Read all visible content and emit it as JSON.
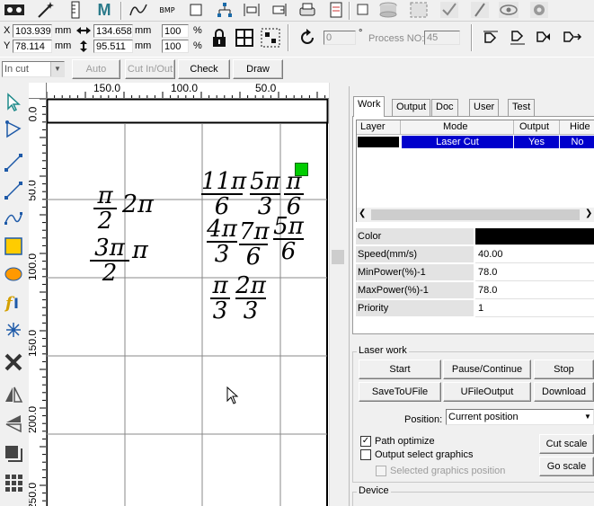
{
  "toolbar": {
    "bmp_label": "BMP",
    "m_label": "M",
    "x_label": "X",
    "y_label": "Y",
    "x_value": "103.939",
    "y_value": "78.114",
    "x_unit": "mm",
    "y_unit": "mm",
    "width_value": "134.658",
    "height_value": "95.511",
    "width_unit": "mm",
    "height_unit": "mm",
    "scale_x": "100",
    "scale_y": "100",
    "pct": "%",
    "rotate_value": "0",
    "degree_sign": "°",
    "process_no_label": "Process NO:",
    "process_no_value": "45"
  },
  "cut_bar": {
    "mode_select": "In cut",
    "auto_label": "Auto",
    "cut_inout_label": "Cut In/Out",
    "check_label": "Check",
    "draw_label": "Draw"
  },
  "ruler": {
    "top_labels": [
      "150.0",
      "100.0",
      "50.0"
    ],
    "left_labels": [
      "0.0",
      "50.0",
      "100.0",
      "150.0",
      "200.0",
      "250.0"
    ]
  },
  "canvas": {
    "math": {
      "f1": {
        "num": "π",
        "den": "2"
      },
      "i1": "2π",
      "f2": {
        "num": "3π",
        "den": "2"
      },
      "i2": "π",
      "f3": {
        "num": "11π",
        "den": "6"
      },
      "f4": {
        "num": "5π",
        "den": "3"
      },
      "f5": {
        "num": "π",
        "den": "6"
      },
      "f6": {
        "num": "4π",
        "den": "3"
      },
      "f7": {
        "num": "7π",
        "den": "6"
      },
      "f8": {
        "num": "5π",
        "den": "6"
      },
      "f9": {
        "num": "π",
        "den": "3"
      },
      "f10": {
        "num": "2π",
        "den": "3"
      }
    }
  },
  "tabs": [
    "Work",
    "Output",
    "Doc",
    "User",
    "Test"
  ],
  "layer_table": {
    "headers": [
      "Layer",
      "Mode",
      "Output",
      "Hide"
    ],
    "rows": [
      {
        "layer_color": "#000000",
        "mode": "Laser Cut",
        "output": "Yes",
        "hide": "No"
      }
    ]
  },
  "properties": [
    {
      "key": "Color",
      "value": "",
      "swatch": "#000000"
    },
    {
      "key": "Speed(mm/s)",
      "value": "40.00"
    },
    {
      "key": "MinPower(%)-1",
      "value": "78.0"
    },
    {
      "key": "MaxPower(%)-1",
      "value": "78.0"
    },
    {
      "key": "Priority",
      "value": "1"
    }
  ],
  "laser_work": {
    "title": "Laser work",
    "start": "Start",
    "pause_continue": "Pause/Continue",
    "stop": "Stop",
    "save_to_ufile": "SaveToUFile",
    "ufile_output": "UFileOutput",
    "download": "Download",
    "position_label": "Position:",
    "position_value": "Current position",
    "path_optimize": "Path optimize",
    "output_select_graphics": "Output select graphics",
    "selected_graphics_position": "Selected graphics position",
    "cut_scale": "Cut scale",
    "go_scale": "Go scale"
  },
  "device": {
    "title": "Device"
  },
  "colors": {
    "selection_blue": "#0000cc",
    "mode_text": "#ffffff",
    "marker_green": "#00cc00",
    "yellow_rect": "#ffcc00",
    "ellipse_orange": "#ff9900"
  }
}
